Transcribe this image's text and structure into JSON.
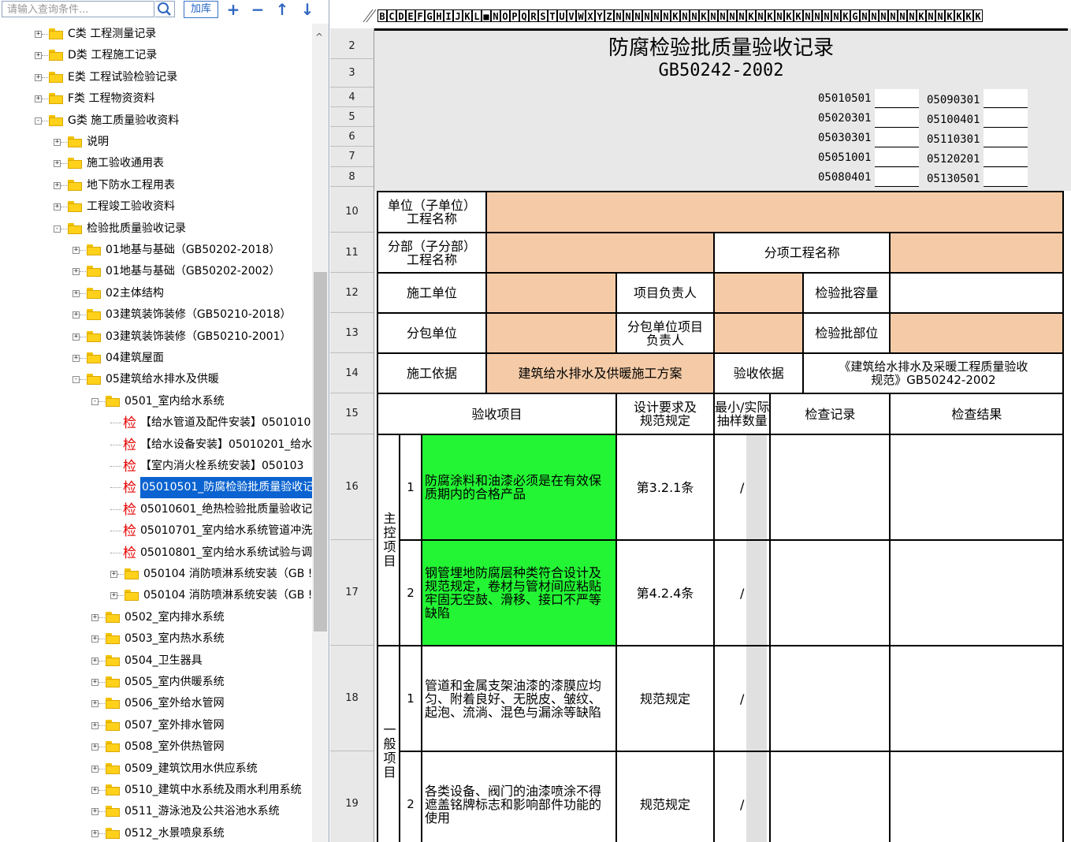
{
  "left_panel": {
    "search_placeholder": "请输入查询条件...",
    "add_library_label": "加库",
    "toolbar_icons": [
      "plus-icon",
      "minus-icon",
      "arrow-up-icon",
      "arrow-down-icon"
    ],
    "tree_items": [
      {
        "label": "C类 工程测量记录",
        "level": 0,
        "type": "folder",
        "expander": "+"
      },
      {
        "label": "D类 工程施工记录",
        "level": 0,
        "type": "folder",
        "expander": "+"
      },
      {
        "label": "E类 工程试验检验记录",
        "level": 0,
        "type": "folder",
        "expander": "+"
      },
      {
        "label": "F类 工程物资资料",
        "level": 0,
        "type": "folder",
        "expander": "+"
      },
      {
        "label": "G类 施工质量验收资料",
        "level": 0,
        "type": "folder",
        "expander": "-"
      },
      {
        "label": "说明",
        "level": 1,
        "type": "folder",
        "expander": "+"
      },
      {
        "label": "施工验收通用表",
        "level": 1,
        "type": "folder",
        "expander": "+"
      },
      {
        "label": "地下防水工程用表",
        "level": 1,
        "type": "folder",
        "expander": "+"
      },
      {
        "label": "工程竣工验收资料",
        "level": 1,
        "type": "folder",
        "expander": "+"
      },
      {
        "label": "检验批质量验收记录",
        "level": 1,
        "type": "folder",
        "expander": "-"
      },
      {
        "label": "01地基与基础（GB50202-2018）",
        "level": 2,
        "type": "folder",
        "expander": "+"
      },
      {
        "label": "01地基与基础（GB50202-2002）",
        "level": 2,
        "type": "folder",
        "expander": "+"
      },
      {
        "label": "02主体结构",
        "level": 2,
        "type": "folder",
        "expander": "+"
      },
      {
        "label": "03建筑装饰装修（GB50210-2018）",
        "level": 2,
        "type": "folder",
        "expander": "+"
      },
      {
        "label": "03建筑装饰装修（GB50210-2001）",
        "level": 2,
        "type": "folder",
        "expander": "+"
      },
      {
        "label": "04建筑屋面",
        "level": 2,
        "type": "folder",
        "expander": "+"
      },
      {
        "label": "05建筑给水排水及供暖",
        "level": 2,
        "type": "folder",
        "expander": "-"
      },
      {
        "label": "0501_室内给水系统",
        "level": 3,
        "type": "folder",
        "expander": "-"
      },
      {
        "label": "【给水管道及配件安装】0501010",
        "level": 4,
        "type": "jian"
      },
      {
        "label": "【给水设备安装】05010201_给水",
        "level": 4,
        "type": "jian"
      },
      {
        "label": "【室内消火栓系统安装】050103",
        "level": 4,
        "type": "jian"
      },
      {
        "label": "05010501_防腐检验批质量验收记",
        "level": 4,
        "type": "jian",
        "selected": true
      },
      {
        "label": "05010601_绝热检验批质量验收记",
        "level": 4,
        "type": "jian"
      },
      {
        "label": "05010701_室内给水系统管道冲洗",
        "level": 4,
        "type": "jian"
      },
      {
        "label": "05010801_室内给水系统试验与调",
        "level": 4,
        "type": "jian"
      },
      {
        "label": "050104 消防喷淋系统安装（GB !",
        "level": 4,
        "type": "folder",
        "expander": "+"
      },
      {
        "label": "050104 消防喷淋系统安装（GB !",
        "level": 4,
        "type": "folder",
        "expander": "+"
      },
      {
        "label": "0502_室内排水系统",
        "level": 3,
        "type": "folder",
        "expander": "+"
      },
      {
        "label": "0503_室内热水系统",
        "level": 3,
        "type": "folder",
        "expander": "+"
      },
      {
        "label": "0504_卫生器具",
        "level": 3,
        "type": "folder",
        "expander": "+"
      },
      {
        "label": "0505_室内供暖系统",
        "level": 3,
        "type": "folder",
        "expander": "+"
      },
      {
        "label": "0506_室外给水管网",
        "level": 3,
        "type": "folder",
        "expander": "+"
      },
      {
        "label": "0507_室外排水管网",
        "level": 3,
        "type": "folder",
        "expander": "+"
      },
      {
        "label": "0508_室外供热管网",
        "level": 3,
        "type": "folder",
        "expander": "+"
      },
      {
        "label": "0509_建筑饮用水供应系统",
        "level": 3,
        "type": "folder",
        "expander": "+"
      },
      {
        "label": "0510_建筑中水系统及雨水利用系统",
        "level": 3,
        "type": "folder",
        "expander": "+"
      },
      {
        "label": "0511_游泳池及公共浴池水系统",
        "level": 3,
        "type": "folder",
        "expander": "+"
      },
      {
        "label": "0512_水景喷泉系统",
        "level": 3,
        "type": "folder",
        "expander": "+"
      }
    ],
    "jian_char": "检"
  },
  "sheet": {
    "column_letters": [
      "B",
      "C",
      "D",
      "E",
      "F",
      "G",
      "H",
      "I",
      "J",
      "K",
      "L",
      "■",
      "N",
      "O",
      "P",
      "Q",
      "R",
      "S",
      "T",
      "U",
      "V",
      "W",
      "X",
      "Y",
      "Z",
      "N",
      "N",
      "N",
      "N",
      "N",
      "N",
      "K",
      "N",
      "N",
      "K",
      "N",
      "N",
      "N",
      "N",
      "K",
      "N",
      "K",
      "N",
      "K",
      "K",
      "N",
      "N",
      "N",
      "N",
      "K",
      "G",
      "N",
      "N",
      "N",
      "N",
      "N",
      "N",
      "K",
      "N",
      "N",
      "K",
      "K",
      "K",
      "K"
    ],
    "row_numbers": [
      "2",
      "3",
      "4",
      "5",
      "6",
      "7",
      "8",
      "10",
      "11",
      "12",
      "13",
      "14",
      "15",
      "16",
      "17",
      "18",
      "19"
    ],
    "title": "防腐检验批质量验收记录",
    "subtitle": "GB50242-2002",
    "codes_left": [
      "05010501",
      "05020301",
      "05030301",
      "05051001",
      "05080401"
    ],
    "codes_right": [
      "05090301",
      "05100401",
      "05110301",
      "05120201",
      "05130501"
    ],
    "form": {
      "unit_label": "单位（子单位）\n工程名称",
      "division_label": "分部（子分部）\n工程名称",
      "subitem_label": "分项工程名称",
      "construction_unit_label": "施工单位",
      "project_manager_label": "项目负责人",
      "batch_capacity_label": "检验批容量",
      "subcontract_unit_label": "分包单位",
      "subcontract_manager_label": "分包单位项目\n负责人",
      "batch_location_label": "检验批部位",
      "construction_basis_label": "施工依据",
      "construction_basis_value": "建筑给水排水及供暖施工方案",
      "acceptance_basis_label": "验收依据",
      "acceptance_basis_value": "《建筑给水排水及采暖工程质量验收\n规范》GB50242-2002",
      "col_item": "验收项目",
      "col_design": "设计要求及\n规范规定",
      "col_sample": "最小/实际\n抽样数量",
      "col_record": "检查记录",
      "col_result": "检查结果",
      "main_group": "主控项目",
      "general_group": "一般项目",
      "items": [
        {
          "no": "1",
          "text": "防腐涂料和油漆必须是在有效保质期内的合格产品",
          "design": "第3.2.1条",
          "sample": "/"
        },
        {
          "no": "2",
          "text": "钢管埋地防腐层种类符合设计及规范规定，卷材与管材间应粘贴牢固无空鼓、滑移、接口不严等缺陷",
          "design": "第4.2.4条",
          "sample": "/"
        },
        {
          "no": "1",
          "text": "管道和金属支架油漆的漆膜应均匀、附着良好、无脱皮、皱纹、起泡、流淌、混色与漏涂等缺陷",
          "design": "规范规定",
          "sample": "/"
        },
        {
          "no": "2",
          "text": "各类设备、阀门的油漆喷涂不得遮盖铭牌标志和影响部件功能的使用",
          "design": "规范规定",
          "sample": "/"
        }
      ]
    }
  }
}
